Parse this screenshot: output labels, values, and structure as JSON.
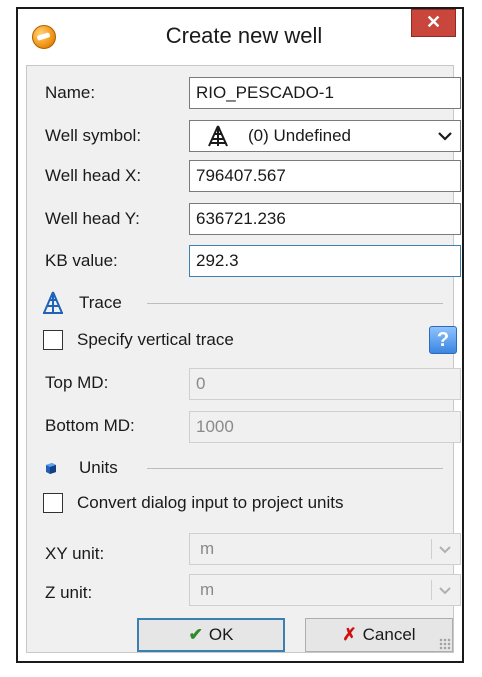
{
  "window": {
    "title": "Create new well",
    "close_glyph": "✕",
    "app_icon": "app-logo-icon"
  },
  "fields": {
    "name": {
      "label": "Name:",
      "value": "RIO_PESCADO-1"
    },
    "well_symbol": {
      "label": "Well symbol:",
      "value": "(0) Undefined",
      "icon": "well-symbol-icon"
    },
    "well_head_x": {
      "label": "Well head X:",
      "value": "796407.567"
    },
    "well_head_y": {
      "label": "Well head Y:",
      "value": "636721.236"
    },
    "kb_value": {
      "label": "KB value:",
      "value": "292.3"
    }
  },
  "trace": {
    "section_label": "Trace",
    "specify_label": "Specify vertical trace",
    "specify_checked": false,
    "help_glyph": "?",
    "top_md": {
      "label": "Top MD:",
      "value": "0"
    },
    "bottom_md": {
      "label": "Bottom MD:",
      "value": "1000"
    }
  },
  "units": {
    "section_label": "Units",
    "convert_label": "Convert dialog input to project units",
    "convert_checked": false,
    "xy_unit": {
      "label": "XY unit:",
      "value": "m"
    },
    "z_unit": {
      "label": "Z unit:",
      "value": "m"
    }
  },
  "buttons": {
    "ok": {
      "label": "OK",
      "glyph": "✔"
    },
    "cancel": {
      "label": "Cancel",
      "glyph": "✗"
    }
  },
  "colors": {
    "ok_check": "#2e8b2e",
    "cancel_x": "#d01010",
    "close_bg": "#c9463d",
    "focus_border": "#3c7fb1"
  }
}
